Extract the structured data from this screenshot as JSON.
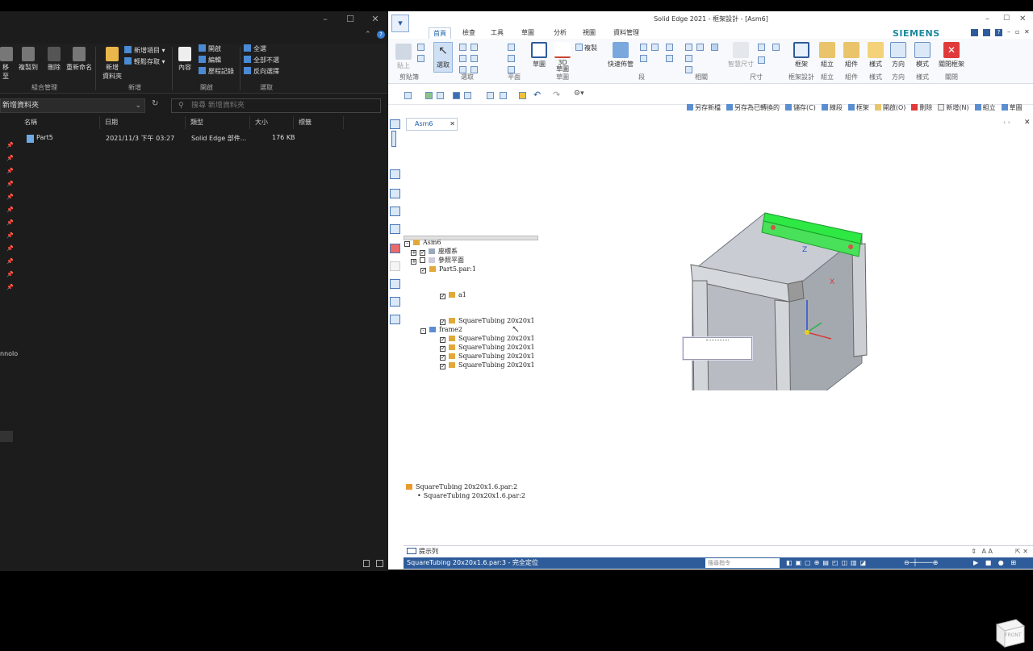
{
  "explorer": {
    "ribbon": {
      "organize": {
        "label": "組合管理",
        "buttons": [
          "移至",
          "複製到",
          "刪除",
          "重新命名"
        ]
      },
      "new": {
        "label": "新增",
        "folder_label": "新增\n資料夾",
        "new_item": "新增項目",
        "easy_access": "輕鬆存取"
      },
      "open": {
        "label": "開啟",
        "properties": "內容",
        "open": "開啟",
        "edit": "編輯",
        "history": "歷程記錄"
      },
      "select": {
        "label": "選取",
        "select_all": "全選",
        "select_none": "全部不選",
        "invert": "反向選擇"
      }
    },
    "address": "新增資料夾",
    "search_placeholder": "搜尋 新增資料夾",
    "columns": [
      "名稱",
      "日期",
      "類型",
      "大小",
      "標籤"
    ],
    "files": [
      {
        "name": "Part5",
        "date": "2021/11/3 下午 03:27",
        "type": "Solid Edge 部件...",
        "size": "176 KB"
      }
    ],
    "truncated_sidebar_text": "nnolo"
  },
  "solidedge": {
    "title": "Solid Edge 2021 - 框架設計 - [Asm6]",
    "brand": "SIEMENS",
    "tabs": [
      "首頁",
      "檢查",
      "工具",
      "草圖",
      "分析",
      "視圖",
      "資料管理"
    ],
    "active_tab": "首頁",
    "ribbon_groups": [
      "剪貼簿",
      "選取",
      "平面",
      "草圖",
      "段",
      "相關",
      "尺寸",
      "框架設計",
      "組立",
      "組件",
      "樣式",
      "方向",
      "樣式",
      "關閉"
    ],
    "ribbon_buttons": {
      "paste": "貼上",
      "select": "選取",
      "sketch": "草圖",
      "projection": "3D\n草圖",
      "copy": "複製",
      "quick_pipe": "快速佈管",
      "smart_dim": "智慧尺寸",
      "frame": "框架",
      "assemble": "組立",
      "component": "組件",
      "style": "樣式",
      "orient": "方向",
      "mode": "模式",
      "close_frame": "關閉框架"
    },
    "command_bar": [
      "另存新檔",
      "另存為已轉換的",
      "儲存(C)",
      "線段",
      "框架",
      "開啟(O)",
      "刪除",
      "新增(N)",
      "組立",
      "草圖"
    ],
    "doc_tab": "Asm6",
    "tree": {
      "root": "Asm6",
      "items": [
        {
          "label": "座標系",
          "checked": true,
          "expand": "+"
        },
        {
          "label": "參照平面",
          "checked": false,
          "expand": "+"
        },
        {
          "label": "Part5.par:1",
          "checked": true
        },
        {
          "label": "a1",
          "checked": true
        },
        {
          "label": "SquareTubing 20x20x1",
          "checked": true
        },
        {
          "label": "frame2",
          "expand": "-"
        },
        {
          "label": "SquareTubing 20x20x1",
          "checked": true
        },
        {
          "label": "SquareTubing 20x20x1",
          "checked": true
        },
        {
          "label": "SquareTubing 20x20x1",
          "checked": true
        },
        {
          "label": "SquareTubing 20x20x1",
          "checked": true
        }
      ]
    },
    "selection_list": [
      "SquareTubing 20x20x1.6.par:2",
      "SquareTubing 20x20x1.6.par:2"
    ],
    "prompt_label": "提示列",
    "status_text": "SquareTubing 20x20x1.6.par:3 - 完全定位",
    "status_search_placeholder": "搜尋指令",
    "navcube_label": "FRONT",
    "axes": {
      "z": "Z",
      "x": "X"
    },
    "colors": {
      "highlight": "#2ee844",
      "status_bar": "#2e5c9a",
      "close_red": "#e03a3a"
    }
  }
}
